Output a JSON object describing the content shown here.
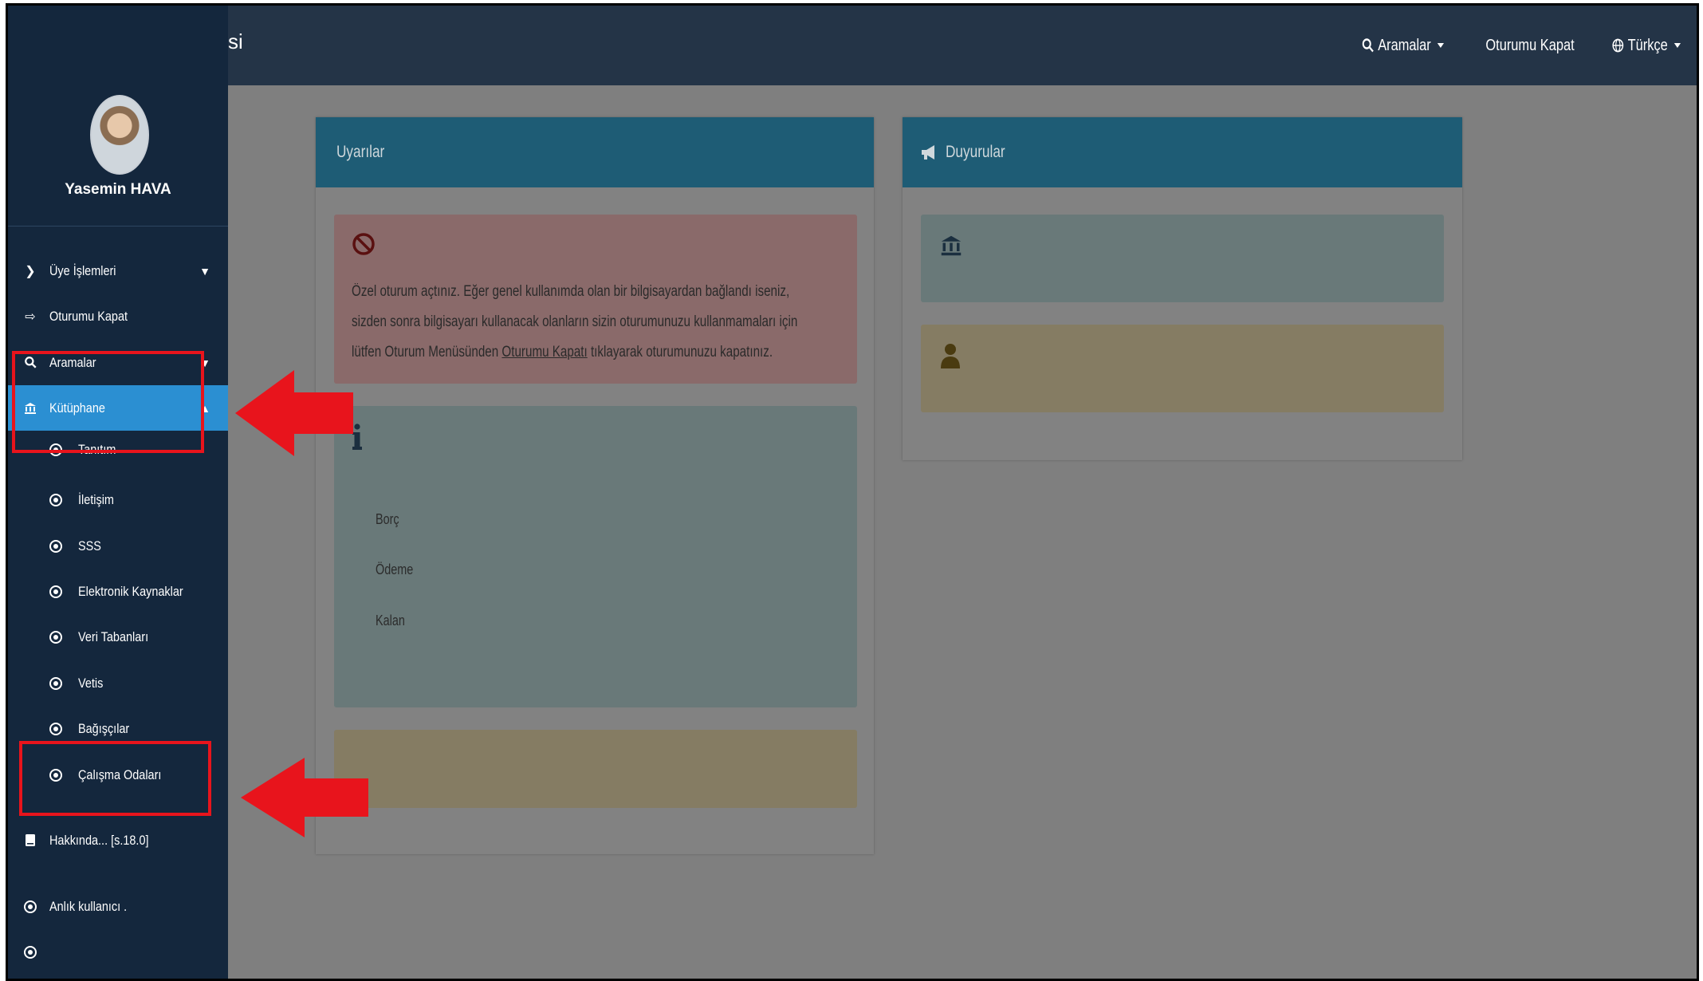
{
  "header": {
    "brand_tail": "si",
    "nav": {
      "search": "Aramalar",
      "logout": "Oturumu Kapat",
      "language": "Türkçe"
    }
  },
  "user": {
    "name": "Yasemin HAVA"
  },
  "sidebar": {
    "items": [
      {
        "label": "Üye İşlemleri"
      },
      {
        "label": "Oturumu Kapat"
      },
      {
        "label": "Aramalar"
      },
      {
        "label": "Kütüphane"
      },
      {
        "label": "Tanıtım"
      },
      {
        "label": "İletişim"
      },
      {
        "label": "SSS"
      },
      {
        "label": "Elektronik Kaynaklar"
      },
      {
        "label": "Veri Tabanları"
      },
      {
        "label": "Vetis"
      },
      {
        "label": "Bağışçılar"
      },
      {
        "label": "Çalışma Odaları"
      },
      {
        "label": "Hakkında... [s.18.0]"
      },
      {
        "label": "Anlık kullanıcı ."
      }
    ]
  },
  "warnings_panel": {
    "title": "Uyarılar",
    "danger_lines": [
      "Özel oturum açtınız. Eğer genel kullanımda olan bir bilgisayardan bağlandı iseniz,",
      "sizden sonra bilgisayarı kullanacak olanların sizin oturumunuzu kullanmamaları için",
      "lütfen Oturum Menüsünden "
    ],
    "logout_link": "Oturumu Kapatı",
    "danger_tail": " tıklayarak oturumunuzu kapatınız.",
    "info_labels": [
      "Borç",
      "Ödeme",
      "Kalan"
    ]
  },
  "announcements_panel": {
    "title": "Duyurular"
  },
  "colors": {
    "sidebar": "#14273d",
    "topbar": "#243447",
    "active_item": "#2b8fd2",
    "panel_header": "#1e5c75",
    "annotation_red": "#e8141c"
  }
}
